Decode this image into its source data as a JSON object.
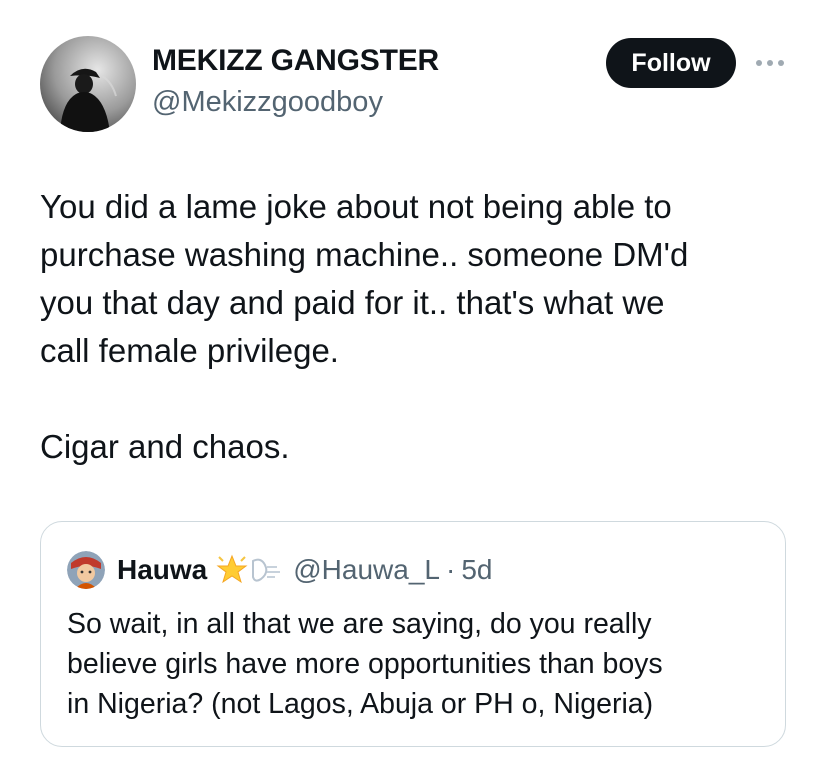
{
  "tweet": {
    "author": {
      "display_name": "MEKIZZ GANGSTER",
      "handle": "@Mekizzgoodboy",
      "avatar_icon": "silhouette-avatar-icon"
    },
    "follow_label": "Follow",
    "more_icon": "ellipsis-icon",
    "text_lines": [
      "You did a lame joke about not being able to",
      "purchase washing machine.. someone DM'd",
      "you that day and paid for it.. that's what we",
      "call female privilege."
    ],
    "text_line_2": "Cigar and chaos."
  },
  "quote": {
    "display_name": "Hauwa",
    "emojis": [
      "glowing-star-icon",
      "wind-face-icon"
    ],
    "handle": "@Hauwa_L",
    "separator": "·",
    "time": "5d",
    "text_lines": [
      "So wait, in all that we are saying, do you really",
      "believe girls have more opportunities than boys",
      "in Nigeria? (not Lagos, Abuja or PH o, Nigeria)"
    ]
  },
  "colors": {
    "text": "#0f1419",
    "secondary": "#536471",
    "button_bg": "#0f1419",
    "border": "#cfd9de"
  }
}
